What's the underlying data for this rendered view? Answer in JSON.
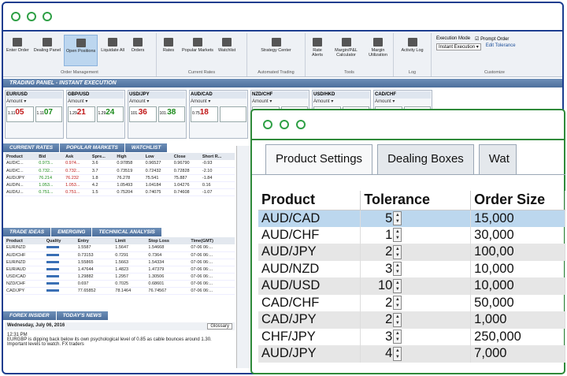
{
  "back_window": {
    "ribbon": {
      "groups": [
        {
          "label": "Order Management",
          "buttons": [
            "Enter Order",
            "Dealing Panel",
            "Open Positions",
            "Liquidate All",
            "Orders"
          ]
        },
        {
          "label": "Current Rates",
          "buttons": [
            "Rates",
            "Popular Markets",
            "Watchlist"
          ]
        },
        {
          "label": "Automated Trading",
          "buttons": [
            "Strategy Center"
          ]
        },
        {
          "label": "Tools",
          "buttons": [
            "Rate Alerts",
            "Margin/P&L Calculator",
            "Margin Utilization"
          ]
        },
        {
          "label": "Log",
          "buttons": [
            "Activity Log"
          ]
        },
        {
          "label": "Customize",
          "execution_mode_label": "Execution Mode",
          "execution_mode_value": "Instant Execution",
          "prompt_order": "Prompt Order",
          "edit_tolerance": "Edit Tolerance"
        }
      ]
    },
    "trading_panel_title": "TRADING PANEL - INSTANT EXECUTION",
    "dealing_boxes": [
      {
        "pair": "EUR/USD",
        "sell": "05",
        "sell_prefix": "1.11",
        "buy": "07",
        "buy_prefix": "1.11"
      },
      {
        "pair": "GBP/USD",
        "sell": "21",
        "sell_prefix": "1.29",
        "buy": "24",
        "buy_prefix": "1.29"
      },
      {
        "pair": "USD/JPY",
        "sell": "36",
        "sell_prefix": "101.",
        "buy": "38",
        "buy_prefix": "101."
      },
      {
        "pair": "AUD/CAD",
        "sell": "18",
        "sell_prefix": "0.75",
        "buy": "",
        "buy_prefix": ""
      },
      {
        "pair": "NZD/CHF",
        "sell": "",
        "sell_prefix": "",
        "buy": "",
        "buy_prefix": ""
      },
      {
        "pair": "USD/HKD",
        "sell": "",
        "sell_prefix": "",
        "buy": "",
        "buy_prefix": ""
      },
      {
        "pair": "CAD/CHF",
        "sell": "",
        "sell_prefix": "",
        "buy": "",
        "buy_prefix": ""
      }
    ],
    "rates_tabs": [
      "CURRENT RATES",
      "POPULAR MARKETS",
      "WATCHLIST"
    ],
    "rates_columns": [
      "Product",
      "Bid",
      "Ask",
      "Spre...",
      "High",
      "Low",
      "Close",
      "Short R..."
    ],
    "rates_rows": [
      [
        "AUD/C...",
        "0.973...",
        "0.974...",
        "3.6",
        "0.97858",
        "0.96527",
        "0.96790",
        "-0.93"
      ],
      [
        "AUD/C...",
        "0.732...",
        "0.732...",
        "3.7",
        "0.73519",
        "0.72432",
        "0.72828",
        "-2.10"
      ],
      [
        "AUD/JPY",
        "76.214",
        "76.232",
        "1.8",
        "76.278",
        "75.541",
        "75.887",
        "-1.84"
      ],
      [
        "AUD/N...",
        "1.053...",
        "1.053...",
        "4.2",
        "1.05493",
        "1.04184",
        "1.04276",
        "0.16"
      ],
      [
        "AUD/U...",
        "0.751...",
        "0.751...",
        "1.5",
        "0.75204",
        "0.74075",
        "0.74608",
        "-1.07"
      ]
    ],
    "ideas_tabs": [
      "TRADE IDEAS",
      "EMERGING",
      "TECHNICAL ANALYSIS"
    ],
    "ideas_columns": [
      "Product",
      "Quality",
      "Entry",
      "Limit",
      "Stop Loss",
      "Time(GMT)"
    ],
    "ideas_rows": [
      [
        "EUR/NZD",
        "1.5587",
        "1.5647",
        "1.54668",
        "07-06 06:..."
      ],
      [
        "AUD/CHF",
        "0.73153",
        "0.7291",
        "0.7364",
        "07-06 06:..."
      ],
      [
        "EUR/NZD",
        "1.55865",
        "1.5663",
        "1.54334",
        "07-06 06:..."
      ],
      [
        "EUR/AUD",
        "1.47644",
        "1.4823",
        "1.47379",
        "07-06 06:..."
      ],
      [
        "USD/CAD",
        "1.29882",
        "1.2957",
        "1.30506",
        "07-06 06:..."
      ],
      [
        "NZD/CHF",
        "0.697",
        "0.7025",
        "0.68601",
        "07-06 06:..."
      ],
      [
        "CAD/JPY",
        "77.65852",
        "78.1464",
        "76.74567",
        "07-06 06:..."
      ]
    ],
    "news_tabs": [
      "FOREX INSIDER",
      "TODAY'S NEWS"
    ],
    "news_date": "Wednesday, July 06, 2016",
    "glossary": "Glossary",
    "news_time": "12:31 PM",
    "news_text": "EURGBP is dipping back below its own psychological level of 0.85 as cable bounces around 1.30. Important levels to watch. FX traders"
  },
  "front_window": {
    "tabs": [
      "Product Settings",
      "Dealing Boxes",
      "Wat"
    ],
    "columns": [
      "Product",
      "Tolerance",
      "Order Size"
    ],
    "rows": [
      {
        "product": "AUD/CAD",
        "tolerance": "5",
        "order_size": "15,000"
      },
      {
        "product": "AUD/CHF",
        "tolerance": "1",
        "order_size": "30,000"
      },
      {
        "product": "AUD/JPY",
        "tolerance": "2",
        "order_size": "100,00"
      },
      {
        "product": "AUD/NZD",
        "tolerance": "3",
        "order_size": "10,000"
      },
      {
        "product": "AUD/USD",
        "tolerance": "10",
        "order_size": "10,000"
      },
      {
        "product": "CAD/CHF",
        "tolerance": "2",
        "order_size": "50,000"
      },
      {
        "product": "CAD/JPY",
        "tolerance": "2",
        "order_size": "1,000"
      },
      {
        "product": "CHF/JPY",
        "tolerance": "3",
        "order_size": "250,000"
      },
      {
        "product": "AUD/JPY",
        "tolerance": "4",
        "order_size": "7,000"
      }
    ]
  },
  "colors": {
    "back_border": "#1c3d8f",
    "front_border": "#2f8a3a",
    "selected_row": "#bcd7ee",
    "buy": "#1a8a1a",
    "sell": "#c01818"
  }
}
